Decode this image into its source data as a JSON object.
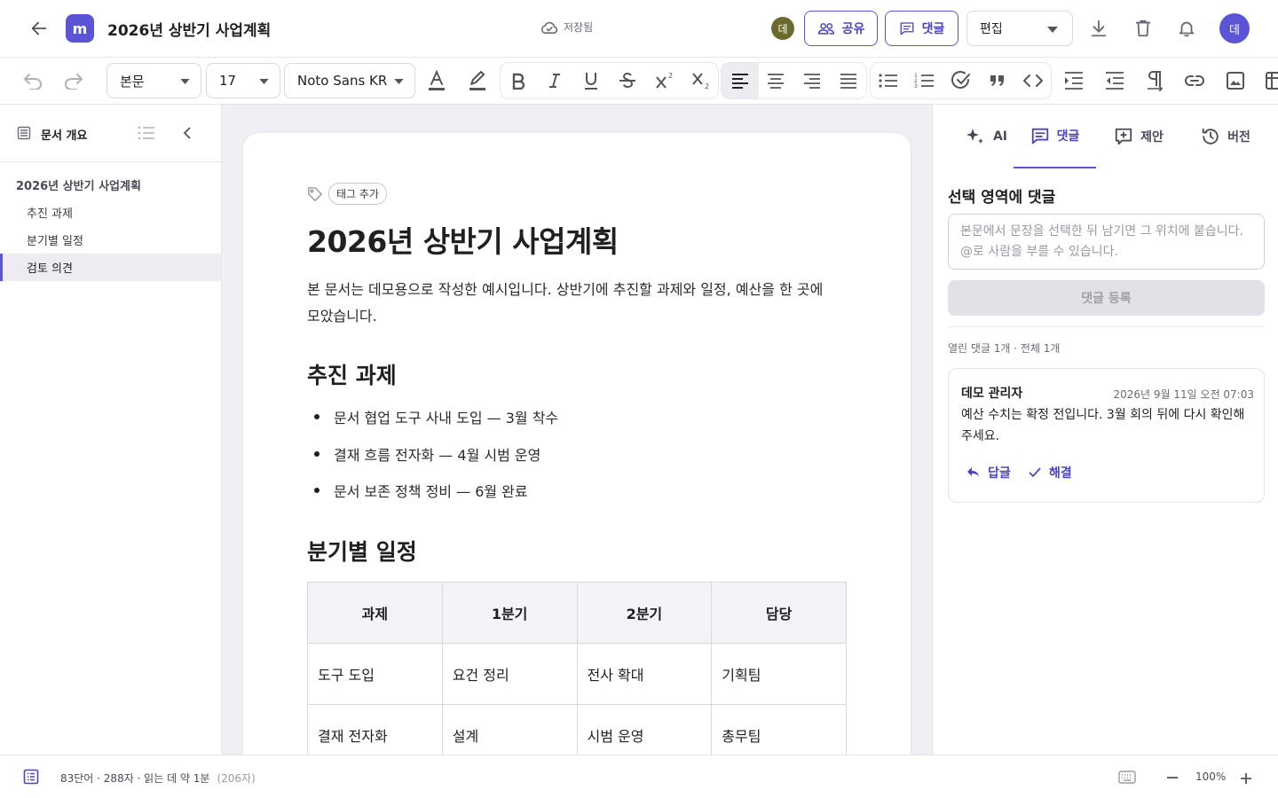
{
  "header": {
    "title": "2026년 상반기 사업계획",
    "app_logo": "m",
    "save_status": "저장됨",
    "presence_avatar": "데",
    "share_label": "공유",
    "comment_label": "댓글",
    "mode_value": "편집",
    "user_avatar": "데"
  },
  "toolbar": {
    "style_value": "본문",
    "size_value": "17",
    "font_value": "Noto Sans KR"
  },
  "outline": {
    "title": "문서 개요",
    "items": [
      {
        "label": "2026년 상반기 사업계획",
        "level": 1
      },
      {
        "label": "추진 과제",
        "level": 2
      },
      {
        "label": "분기별 일정",
        "level": 2
      },
      {
        "label": "검토 의견",
        "level": 2,
        "active": true
      }
    ]
  },
  "document": {
    "tag_add_label": "태그 추가",
    "title": "2026년 상반기 사업계획",
    "intro": "본 문서는 데모용으로 작성한 예시입니다. 상반기에 추진할 과제와 일정, 예산을 한 곳에 모았습니다.",
    "section1_title": "추진 과제",
    "bullets": [
      "문서 협업 도구 사내 도입 — 3월 착수",
      "결재 흐름 전자화 — 4월 시범 운영",
      "문서 보존 정책 정비 — 6월 완료"
    ],
    "section2_title": "분기별 일정",
    "table": {
      "headers": [
        "과제",
        "1분기",
        "2분기",
        "담당"
      ],
      "rows": [
        [
          "도구 도입",
          "요건 정리",
          "전사 확대",
          "기획팀"
        ],
        [
          "결재 전자화",
          "설계",
          "시범 운영",
          "총무팀"
        ]
      ]
    }
  },
  "right_panel": {
    "tabs": [
      {
        "label": "AI",
        "icon": "sparkle-icon"
      },
      {
        "label": "댓글",
        "icon": "comment-icon",
        "active": true
      },
      {
        "label": "제안",
        "icon": "suggest-icon"
      },
      {
        "label": "버전",
        "icon": "history-icon"
      }
    ],
    "section_title": "선택 영역에 댓글",
    "input_placeholder": "본문에서 문장을 선택한 뒤 남기면 그 위치에 붙습니다. @로 사람을 부를 수 있습니다.",
    "submit_label": "댓글 등록",
    "count_text": "열린 댓글 1개 · 전체 1개",
    "comment": {
      "author": "데모 관리자",
      "timestamp": "2026년 9월 11일 오전 07:03",
      "body": "예산 수치는 확정 전입니다. 3월 회의 뒤에 다시 확인해 주세요.",
      "reply_label": "답글",
      "resolve_label": "해결"
    }
  },
  "statusbar": {
    "stats": "83단어 · 288자 · 읽는 데 약 1분",
    "chars": "(206자)",
    "zoom": "100%"
  },
  "colors": {
    "accent": "#5b54d6",
    "accent_text": "#4a44c4",
    "canvas_bg": "#f0f0f4"
  }
}
